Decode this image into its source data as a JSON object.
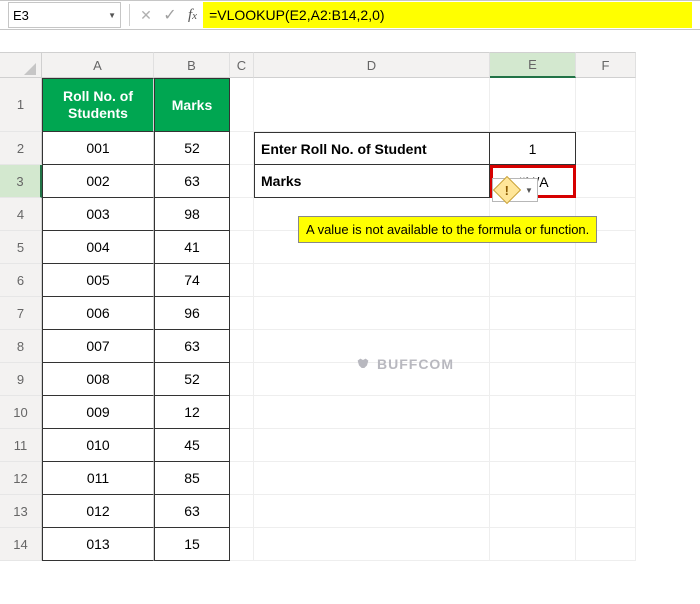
{
  "formula_bar": {
    "cell_ref": "E3",
    "formula": "=VLOOKUP(E2,A2:B14,2,0)"
  },
  "columns": {
    "A": "A",
    "B": "B",
    "C": "C",
    "D": "D",
    "E": "E",
    "F": "F"
  },
  "headers": {
    "roll": "Roll No. of Students",
    "marks": "Marks"
  },
  "lookup": {
    "prompt": "Enter Roll No. of Student",
    "value": "1",
    "marks_label": "Marks",
    "result": "#N/A"
  },
  "tooltip": "A value is not available to the formula or function.",
  "watermark": "BUFFCOM",
  "rows": [
    {
      "n": "1"
    },
    {
      "n": "2",
      "roll": "001",
      "marks": "52"
    },
    {
      "n": "3",
      "roll": "002",
      "marks": "63"
    },
    {
      "n": "4",
      "roll": "003",
      "marks": "98"
    },
    {
      "n": "5",
      "roll": "004",
      "marks": "41"
    },
    {
      "n": "6",
      "roll": "005",
      "marks": "74"
    },
    {
      "n": "7",
      "roll": "006",
      "marks": "96"
    },
    {
      "n": "8",
      "roll": "007",
      "marks": "63"
    },
    {
      "n": "9",
      "roll": "008",
      "marks": "52"
    },
    {
      "n": "10",
      "roll": "009",
      "marks": "12"
    },
    {
      "n": "11",
      "roll": "010",
      "marks": "45"
    },
    {
      "n": "12",
      "roll": "011",
      "marks": "85"
    },
    {
      "n": "13",
      "roll": "012",
      "marks": "63"
    },
    {
      "n": "14",
      "roll": "013",
      "marks": "15"
    }
  ]
}
